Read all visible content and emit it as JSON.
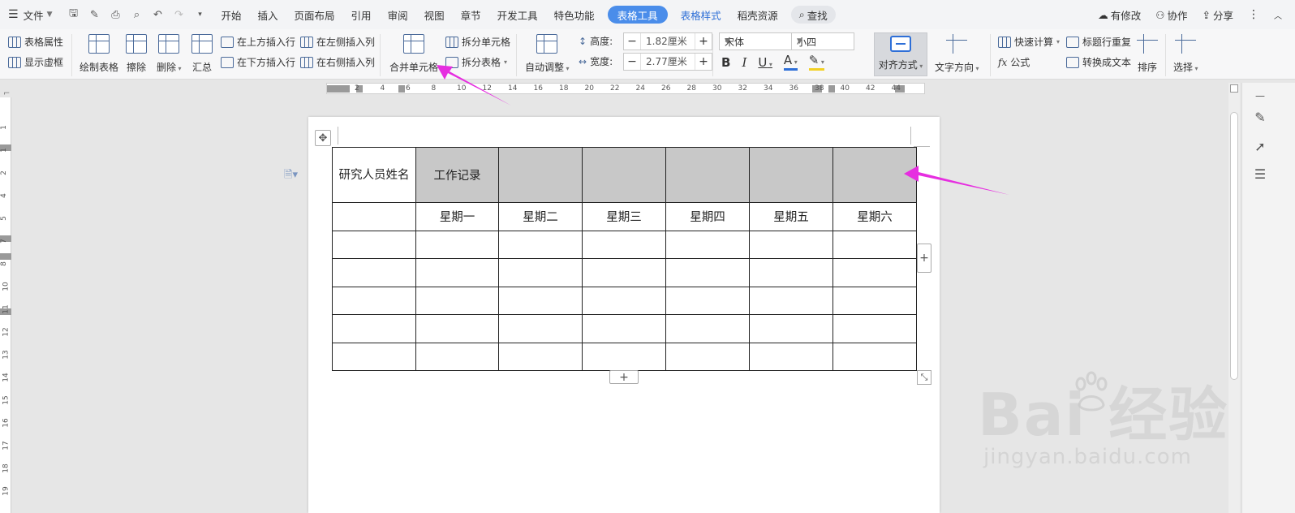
{
  "menubar": {
    "file_label": "文件",
    "tabs": [
      "开始",
      "插入",
      "页面布局",
      "引用",
      "审阅",
      "视图",
      "章节",
      "开发工具",
      "特色功能"
    ],
    "active_tab": "表格工具",
    "style_tab": "表格样式",
    "resource_tab": "稻壳资源",
    "search_label": "查找",
    "right": {
      "modified": "有修改",
      "collab": "协作",
      "share": "分享"
    }
  },
  "ribbon": {
    "table_props": "表格属性",
    "show_grid": "显示虚框",
    "draw_table": "绘制表格",
    "erase": "擦除",
    "delete": "删除",
    "summary": "汇总",
    "insert_above": "在上方插入行",
    "insert_below": "在下方插入行",
    "insert_left": "在左侧插入列",
    "insert_right": "在右侧插入列",
    "merge_cells": "合并单元格",
    "split_cells": "拆分单元格",
    "split_table": "拆分表格",
    "auto_fit": "自动调整",
    "height_label": "高度:",
    "height_value": "1.82厘米",
    "width_label": "宽度:",
    "width_value": "2.77厘米",
    "font_name": "宋体",
    "font_size": "小四",
    "align": "对齐方式",
    "text_direction": "文字方向",
    "quick_calc": "快速计算",
    "formula": "公式",
    "repeat_header": "标题行重复",
    "to_text": "转换成文本",
    "sort": "排序",
    "select": "选择"
  },
  "ruler": {
    "h_ticks": [
      "2",
      "4",
      "6",
      "8",
      "10",
      "12",
      "14",
      "16",
      "18",
      "20",
      "22",
      "24",
      "26",
      "28",
      "30",
      "32",
      "34",
      "36",
      "38",
      "40",
      "42",
      "44"
    ],
    "v_ticks": [
      "1",
      "1",
      "2",
      "4",
      "5",
      "7",
      "8",
      "10",
      "11",
      "12",
      "13",
      "14",
      "15",
      "16",
      "17",
      "18",
      "19"
    ]
  },
  "table": {
    "header_row": [
      "研究人员姓名",
      "工作记录",
      "",
      "",
      "",
      "",
      ""
    ],
    "day_row": [
      "",
      "星期一",
      "星期二",
      "星期三",
      "星期四",
      "星期五",
      "星期六"
    ],
    "empty_rows": 5
  },
  "watermark": {
    "brand": "Bai  经验",
    "url": "jingyan.baidu.com"
  },
  "colors": {
    "active_tab": "#4a8dea",
    "arrow": "#e62ee0",
    "shade": "#c8c8c8"
  }
}
